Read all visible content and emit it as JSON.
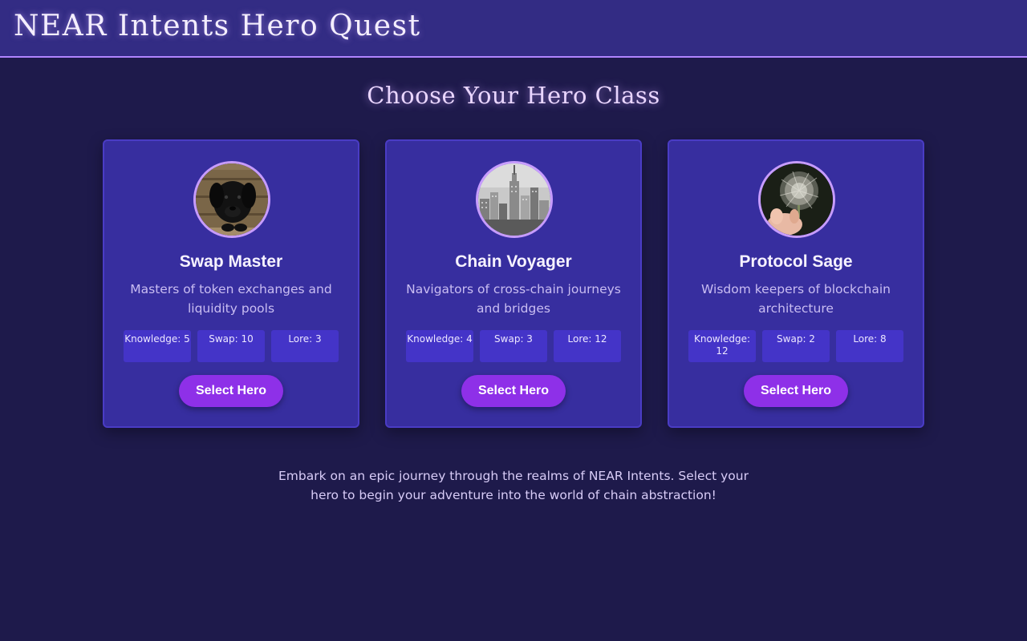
{
  "header": {
    "title": "NEAR Intents Hero Quest"
  },
  "page": {
    "subtitle": "Choose Your Hero Class",
    "intro": "Embark on an epic journey through the realms of NEAR Intents. Select your hero to begin your adventure into the world of chain abstraction!"
  },
  "heroes": [
    {
      "name": "Swap Master",
      "description": "Masters of token exchanges and liquidity pools",
      "avatar": "black-puppy-photo",
      "stats": [
        "Knowledge: 5",
        "Swap: 10",
        "Lore: 3"
      ],
      "button_label": "Select Hero"
    },
    {
      "name": "Chain Voyager",
      "description": "Navigators of cross-chain journeys and bridges",
      "avatar": "city-skyline-photo",
      "stats": [
        "Knowledge: 4",
        "Swap: 3",
        "Lore: 12"
      ],
      "button_label": "Select Hero"
    },
    {
      "name": "Protocol Sage",
      "description": "Wisdom keepers of blockchain architecture",
      "avatar": "dandelion-photo",
      "stats": [
        "Knowledge: 12",
        "Swap: 2",
        "Lore: 8"
      ],
      "button_label": "Select Hero"
    }
  ],
  "colors": {
    "background": "#1e1a4b",
    "header": "#332c84",
    "card": "#372e9f",
    "stat": "#4434c8",
    "button": "#8e30e8",
    "accent": "#c79cff"
  }
}
